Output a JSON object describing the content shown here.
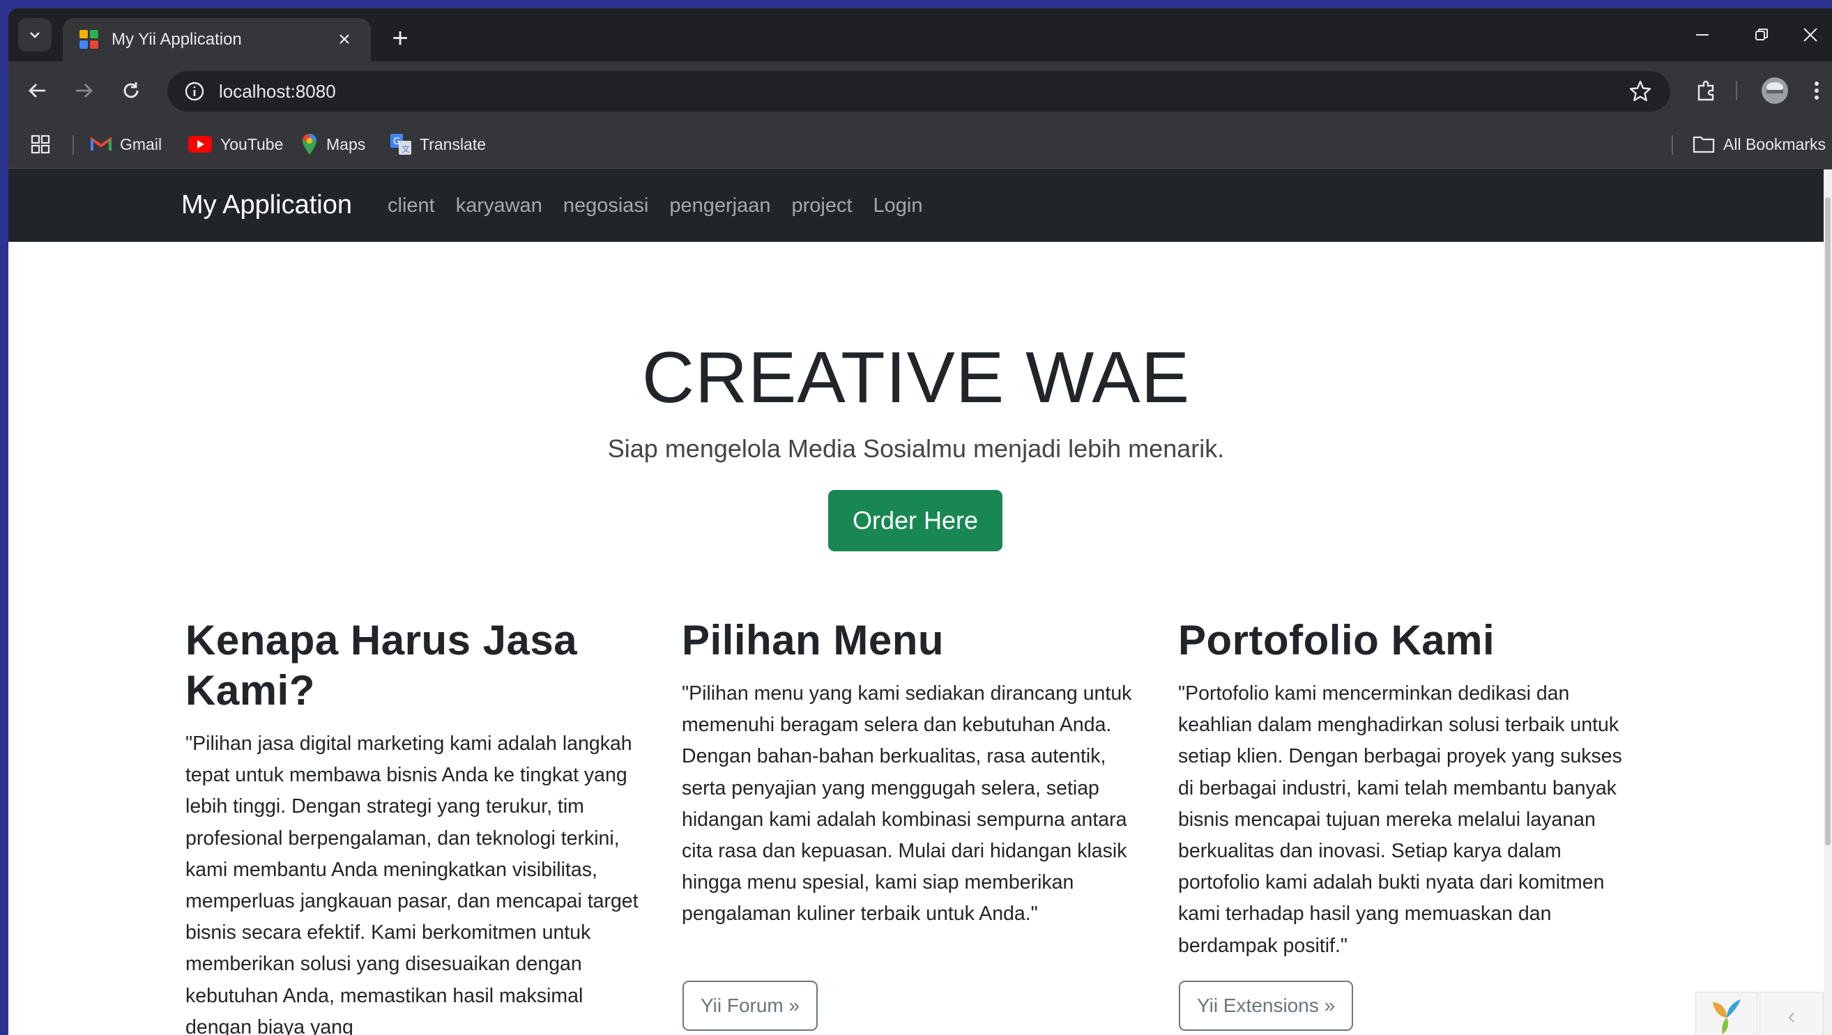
{
  "browser": {
    "tab_title": "My Yii Application",
    "tab_close": "×",
    "new_tab": "+",
    "url": "localhost:8080",
    "bookmarks": [
      {
        "label": "Gmail",
        "icon": "gmail-icon"
      },
      {
        "label": "YouTube",
        "icon": "youtube-icon"
      },
      {
        "label": "Maps",
        "icon": "maps-icon"
      },
      {
        "label": "Translate",
        "icon": "translate-icon"
      }
    ],
    "all_bookmarks": "All Bookmarks"
  },
  "site": {
    "brand": "My Application",
    "nav": [
      "client",
      "karyawan",
      "negosiasi",
      "pengerjaan",
      "project",
      "Login"
    ],
    "hero": {
      "title": "CREATIVE WAE",
      "lead": "Siap mengelola Media Sosialmu menjadi lebih menarik.",
      "button": "Order Here"
    },
    "columns": [
      {
        "heading": "Kenapa Harus Jasa Kami?",
        "body": "\"Pilihan jasa digital marketing kami adalah langkah tepat untuk membawa bisnis Anda ke tingkat yang lebih tinggi. Dengan strategi yang terukur, tim profesional berpengalaman, dan teknologi terkini, kami membantu Anda meningkatkan visibilitas, memperluas jangkauan pasar, dan mencapai target bisnis secara efektif. Kami berkomitmen untuk memberikan solusi yang disesuaikan dengan kebutuhan Anda, memastikan hasil maksimal dengan biaya yang"
      },
      {
        "heading": "Pilihan Menu",
        "body": "\"Pilihan menu yang kami sediakan dirancang untuk memenuhi beragam selera dan kebutuhan Anda. Dengan bahan-bahan berkualitas, rasa autentik, serta penyajian yang menggugah selera, setiap hidangan kami adalah kombinasi sempurna antara cita rasa dan kepuasan. Mulai dari hidangan klasik hingga menu spesial, kami siap memberikan pengalaman kuliner terbaik untuk Anda.\"",
        "button": "Yii Forum »"
      },
      {
        "heading": "Portofolio Kami",
        "body": "\"Portofolio kami mencerminkan dedikasi dan keahlian dalam menghadirkan solusi terbaik untuk setiap klien. Dengan berbagai proyek yang sukses di berbagai industri, kami telah membantu banyak bisnis mencapai tujuan mereka melalui layanan berkualitas dan inovasi. Setiap karya dalam portofolio kami adalah bukti nyata dari komitmen kami terhadap hasil yang memuaskan dan berdampak positif.\"",
        "button": "Yii Extensions »"
      }
    ],
    "debug_toggle": "‹"
  }
}
